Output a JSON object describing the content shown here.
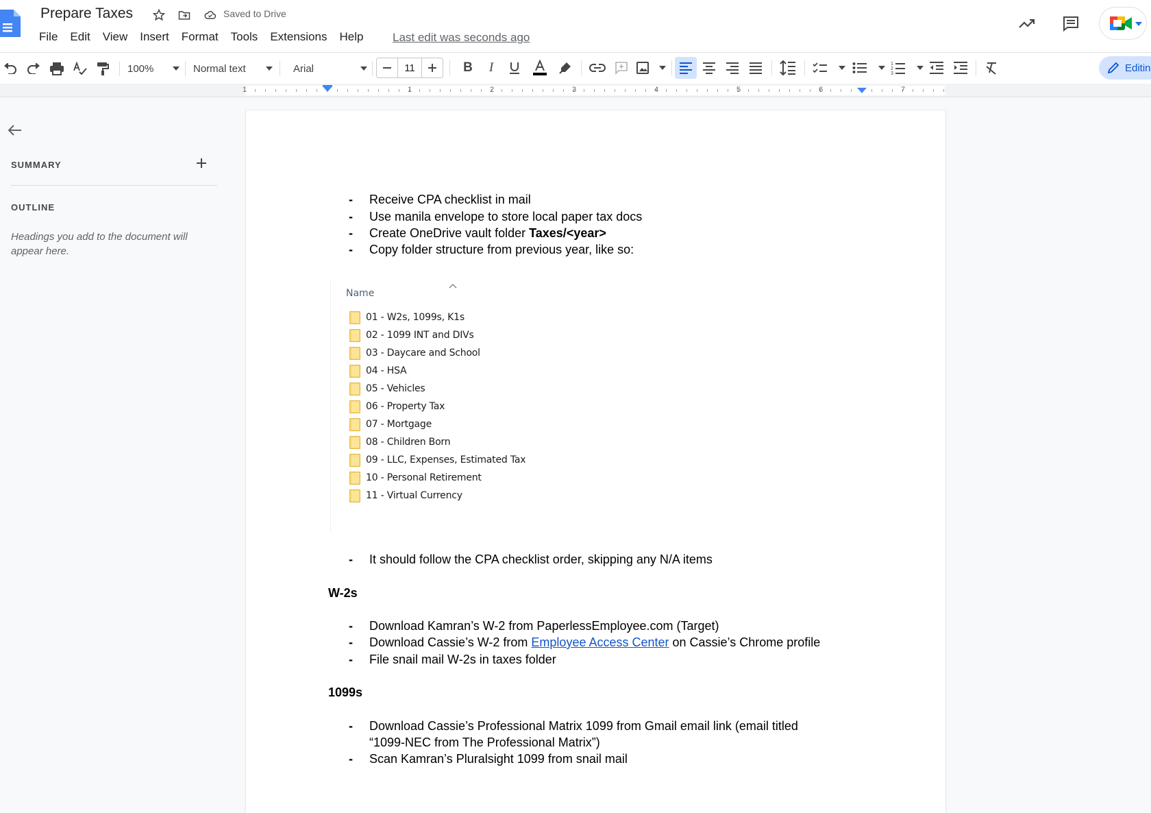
{
  "header": {
    "title": "Prepare Taxes",
    "saved_status": "Saved to Drive",
    "menu": [
      "File",
      "Edit",
      "View",
      "Insert",
      "Format",
      "Tools",
      "Extensions",
      "Help"
    ],
    "last_edit": "Last edit was seconds ago"
  },
  "toolbar": {
    "zoom": "100%",
    "style": "Normal text",
    "font": "Arial",
    "font_size": "11",
    "editing_label": "Editing"
  },
  "ruler": {
    "numbers": [
      "1",
      "1",
      "2",
      "3",
      "4",
      "5",
      "6",
      "7"
    ]
  },
  "sidebar": {
    "summary_label": "SUMMARY",
    "outline_label": "OUTLINE",
    "outline_hint": "Headings you add to the document will appear here."
  },
  "document": {
    "intro_items": [
      {
        "text": "Receive CPA checklist in mail"
      },
      {
        "text": "Use manila envelope to store local paper tax docs"
      },
      {
        "text_before": "Create OneDrive vault folder ",
        "bold": "Taxes/<year>"
      },
      {
        "text": "Copy folder structure from previous year, like so:"
      }
    ],
    "explorer": {
      "column_header": "Name",
      "folders": [
        "01 - W2s, 1099s, K1s",
        "02 - 1099 INT and DIVs",
        "03 - Daycare and School",
        "04 - HSA",
        "05 - Vehicles",
        "06 - Property Tax",
        "07 - Mortgage",
        "08 - Children Born",
        "09 - LLC, Expenses, Estimated Tax",
        "10 - Personal Retirement",
        "11 - Virtual Currency"
      ]
    },
    "follow_item": "It should follow the CPA checklist order, skipping any N/A items",
    "w2_heading": "W-2s",
    "w2_items": {
      "item1": "Download Kamran’s W-2 from PaperlessEmployee.com (Target)",
      "item2_before": "Download Cassie’s W-2 from ",
      "item2_link": "Employee Access Center",
      "item2_after": " on Cassie’s Chrome profile",
      "item3": "File snail mail W-2s in taxes folder"
    },
    "h1099_heading": "1099s",
    "h1099_items": {
      "item1_line1": "Download Cassie’s Professional Matrix 1099 from Gmail email link (email titled",
      "item1_line2": "“1099-NEC from The Professional Matrix”)",
      "item2": "Scan Kamran’s Pluralsight 1099 from snail mail"
    },
    "bullet_char": "-"
  },
  "colors": {
    "accent": "#0b57d0",
    "link": "#1155cc",
    "folder": "#f8d775"
  }
}
